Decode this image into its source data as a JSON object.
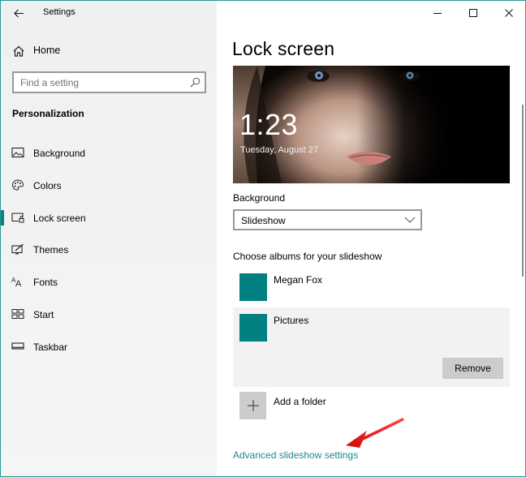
{
  "window": {
    "title": "Settings",
    "accent_color": "#0e7f84",
    "border_color": "#2a9a9b"
  },
  "titlebar": {
    "back_icon": "back-arrow-icon",
    "minimize_icon": "minimize-icon",
    "maximize_icon": "maximize-icon",
    "close_icon": "close-icon"
  },
  "sidebar": {
    "home": {
      "label": "Home",
      "icon": "home-icon"
    },
    "search": {
      "placeholder": "Find a setting",
      "value": "",
      "icon": "search-icon"
    },
    "section_title": "Personalization",
    "items": [
      {
        "label": "Background",
        "icon": "picture-icon",
        "active": false
      },
      {
        "label": "Colors",
        "icon": "palette-icon",
        "active": false
      },
      {
        "label": "Lock screen",
        "icon": "lock-screen-icon",
        "active": true
      },
      {
        "label": "Themes",
        "icon": "themes-icon",
        "active": false
      },
      {
        "label": "Fonts",
        "icon": "fonts-icon",
        "active": false
      },
      {
        "label": "Start",
        "icon": "start-icon",
        "active": false
      },
      {
        "label": "Taskbar",
        "icon": "taskbar-icon",
        "active": false
      }
    ]
  },
  "main": {
    "page_title": "Lock screen",
    "preview": {
      "time": "1:23",
      "date": "Tuesday, August 27"
    },
    "background": {
      "label": "Background",
      "selected": "Slideshow"
    },
    "albums": {
      "label": "Choose albums for your slideshow",
      "items": [
        {
          "name": "Megan Fox",
          "thumb_color": "#008080",
          "selected": false
        },
        {
          "name": "Pictures",
          "thumb_color": "#008080",
          "selected": true
        }
      ],
      "remove_label": "Remove",
      "add_folder_label": "Add a folder"
    },
    "advanced_link": "Advanced slideshow settings",
    "link_color": "#1a8a8f"
  },
  "annotation": {
    "type": "red-arrow",
    "color": "#e8141a",
    "points_to": "Advanced slideshow settings"
  }
}
